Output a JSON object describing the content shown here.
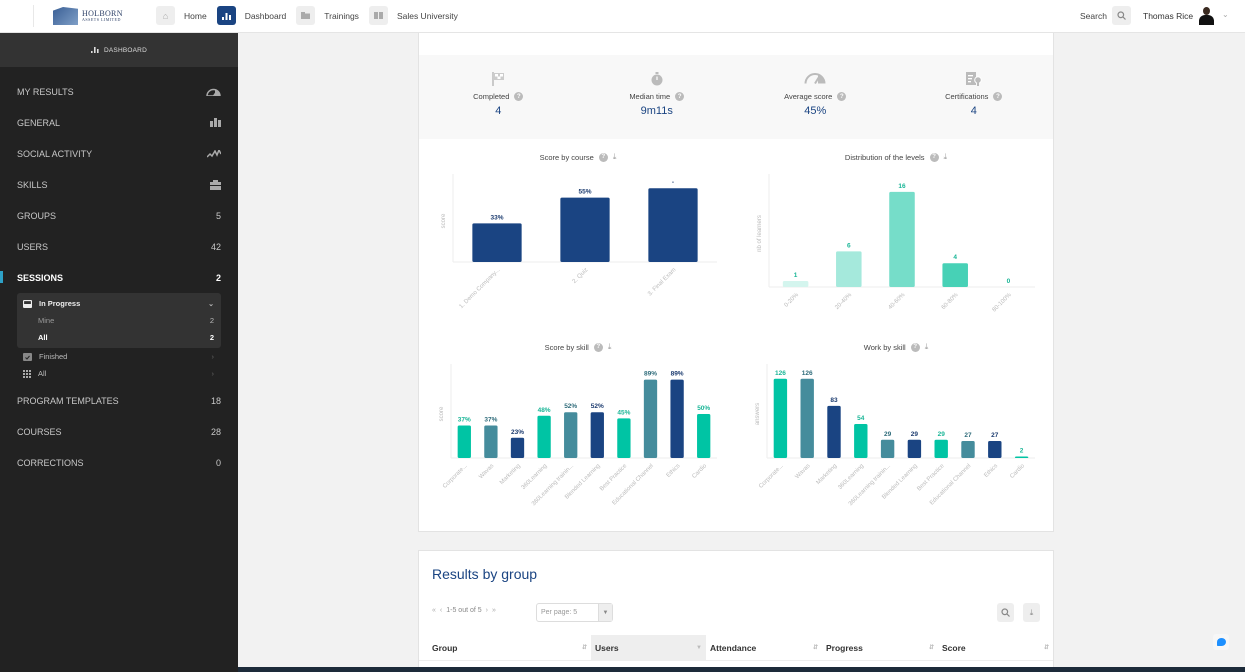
{
  "topbar": {
    "logo": {
      "line1": "HOLBORN",
      "line2": "ASSETS LIMITED"
    },
    "nav": [
      {
        "label": "Home",
        "icon": "home-icon",
        "active": false
      },
      {
        "label": "Dashboard",
        "icon": "bar-chart-icon",
        "active": true
      },
      {
        "label": "Trainings",
        "icon": "folder-icon",
        "active": false
      },
      {
        "label": "Sales University",
        "icon": "book-icon",
        "active": false
      }
    ],
    "search_label": "Search",
    "user_name": "Thomas Rice"
  },
  "sidebar": {
    "header": "DASHBOARD",
    "items": [
      {
        "label": "MY RESULTS",
        "icon": "gauge-icon"
      },
      {
        "label": "GENERAL",
        "icon": "bar-chart-icon"
      },
      {
        "label": "SOCIAL ACTIVITY",
        "icon": "activity-icon"
      },
      {
        "label": "SKILLS",
        "icon": "toolbox-icon"
      },
      {
        "label": "GROUPS",
        "count": "5"
      },
      {
        "label": "USERS",
        "count": "42"
      },
      {
        "label": "SESSIONS",
        "count": "2",
        "active": true
      }
    ],
    "sessions_sub": {
      "in_progress": {
        "label": "In Progress",
        "children": [
          {
            "label": "Mine",
            "count": "2"
          },
          {
            "label": "All",
            "count": "2",
            "selected": true
          }
        ]
      },
      "finished": "Finished",
      "all": "All"
    },
    "items_after": [
      {
        "label": "PROGRAM TEMPLATES",
        "count": "18"
      },
      {
        "label": "COURSES",
        "count": "28"
      },
      {
        "label": "CORRECTIONS",
        "count": "0"
      }
    ]
  },
  "stats": [
    {
      "label": "Completed",
      "value": "4",
      "icon": "checkered-flag-icon"
    },
    {
      "label": "Median time",
      "value": "9m11s",
      "icon": "stopwatch-icon"
    },
    {
      "label": "Average score",
      "value": "45%",
      "icon": "gauge-icon"
    },
    {
      "label": "Certifications",
      "value": "4",
      "icon": "certificate-icon"
    }
  ],
  "colors": {
    "navy": "#1a4482",
    "teal": "#00c4a4",
    "steel": "#458c9c"
  },
  "chart_data": [
    {
      "type": "bar",
      "title": "Score by course",
      "xlabel": "",
      "ylabel": "score",
      "categories": [
        "1. Demo Company...",
        "2. Quiz",
        "3. Final Exam"
      ],
      "values": [
        33,
        55,
        63
      ],
      "labels": [
        "33%",
        "55%",
        "-"
      ],
      "colors": [
        "#1a4482",
        "#1a4482",
        "#1a4482"
      ],
      "ylim": [
        0,
        70
      ]
    },
    {
      "type": "bar",
      "title": "Distribution of the levels",
      "xlabel": "",
      "ylabel": "nb of learners",
      "categories": [
        "0-20%",
        "20-40%",
        "40-60%",
        "60-80%",
        "80-100%"
      ],
      "values": [
        1,
        6,
        16,
        4,
        0
      ],
      "labels": [
        "1",
        "6",
        "16",
        "4",
        "0"
      ],
      "colors": [
        "#d4f5ee",
        "#a5e9dc",
        "#76ddc9",
        "#47d1b6",
        "#18c5a3"
      ],
      "label_color": "#18b596",
      "ylim": [
        0,
        18
      ]
    },
    {
      "type": "bar",
      "title": "Score by skill",
      "xlabel": "",
      "ylabel": "score",
      "categories": [
        "Corporate...",
        "Wavas",
        "Marketing",
        "360Learning",
        "360Learning trainin...",
        "Blended Learning",
        "Best Practice",
        "Educational Channel",
        "Ethics",
        "Cardio"
      ],
      "values": [
        37,
        37,
        23,
        48,
        52,
        52,
        45,
        89,
        89,
        50
      ],
      "labels": [
        "37%",
        "37%",
        "23%",
        "48%",
        "52%",
        "52%",
        "45%",
        "89%",
        "89%",
        "50%"
      ],
      "colors": [
        "#00c4a4",
        "#458c9c",
        "#1a4482",
        "#00c4a4",
        "#458c9c",
        "#1a4482",
        "#00c4a4",
        "#458c9c",
        "#1a4482",
        "#00c4a4"
      ],
      "ylim": [
        0,
        100
      ]
    },
    {
      "type": "bar",
      "title": "Work by skill",
      "xlabel": "",
      "ylabel": "answers",
      "categories": [
        "Corporate...",
        "Wavas",
        "Marketing",
        "360Learning",
        "360Learning trainin...",
        "Blended Learning",
        "Best Practice",
        "Educational Channel",
        "Ethics",
        "Cardio"
      ],
      "values": [
        126,
        126,
        83,
        54,
        29,
        29,
        29,
        27,
        27,
        2
      ],
      "labels": [
        "126",
        "126",
        "83",
        "54",
        "29",
        "29",
        "29",
        "27",
        "27",
        "2"
      ],
      "colors": [
        "#00c4a4",
        "#458c9c",
        "#1a4482",
        "#00c4a4",
        "#458c9c",
        "#1a4482",
        "#00c4a4",
        "#458c9c",
        "#1a4482",
        "#00c4a4"
      ],
      "ylim": [
        0,
        140
      ]
    }
  ],
  "results": {
    "title": "Results by group",
    "pagination": "1-5 out of 5",
    "per_page": "Per page: 5",
    "columns": [
      {
        "label": "Group",
        "sort": "both"
      },
      {
        "label": "Users",
        "sort": "desc",
        "sorted": true
      },
      {
        "label": "Attendance",
        "sort": "both"
      },
      {
        "label": "Progress",
        "sort": "both"
      },
      {
        "label": "Score",
        "sort": "both"
      }
    ]
  }
}
